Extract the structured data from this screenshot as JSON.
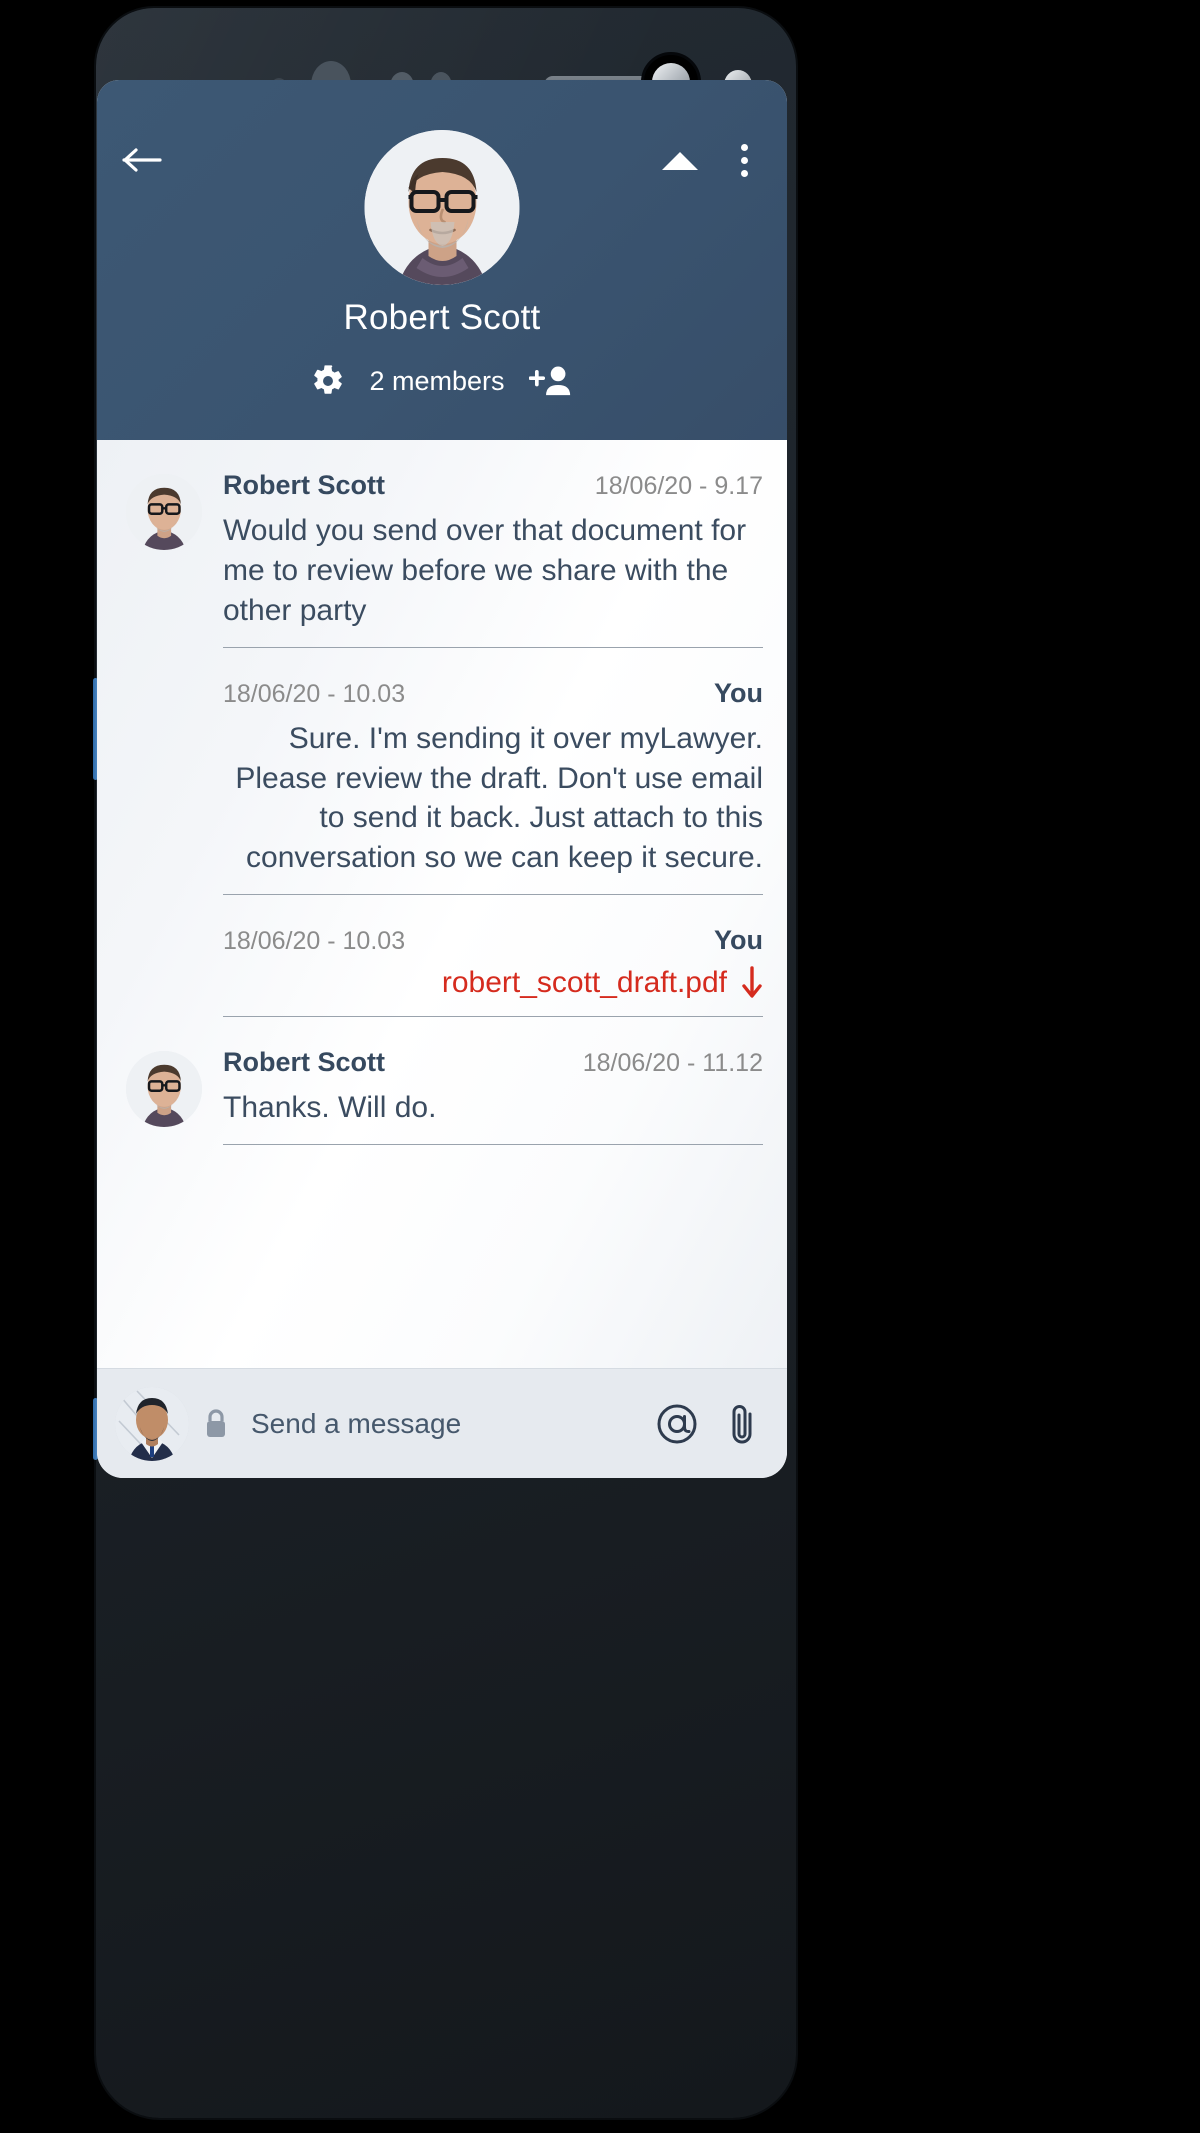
{
  "device": {
    "frame_color": "#1c2228",
    "side_buttons": [
      "volume",
      "power"
    ]
  },
  "header": {
    "title": "Robert Scott",
    "members_label": "2 members",
    "back_icon": "arrow-left-icon",
    "collapse_icon": "triangle-up-icon",
    "overflow_icon": "more-vertical-icon",
    "settings_icon": "gear-icon",
    "add_member_icon": "person-add-icon",
    "background_color": "#3a5470"
  },
  "messages": [
    {
      "sender": "Robert Scott",
      "time": "18/06/20 - 9.17",
      "text": "Would you send over that document for me to review before we share with the other party",
      "direction": "incoming",
      "has_avatar": true
    },
    {
      "sender": "You",
      "time": "18/06/20 - 10.03",
      "text": "Sure.  I'm sending it over myLawyer.  Please review the draft.  Don't use email to send it back.  Just attach to this conversation so we can keep it secure.",
      "direction": "outgoing",
      "has_avatar": false
    },
    {
      "sender": "You",
      "time": "18/06/20 - 10.03",
      "attachment": "robert_scott_draft.pdf",
      "attachment_color": "#d52b1e",
      "download_icon": "download-arrow-icon",
      "direction": "outgoing",
      "has_avatar": false
    },
    {
      "sender": "Robert Scott",
      "time": "18/06/20 - 11.12",
      "text": "Thanks. Will do.",
      "direction": "incoming",
      "has_avatar": true
    }
  ],
  "composer": {
    "placeholder": "Send a message",
    "value": "",
    "lock_icon": "lock-icon",
    "mention_icon": "at-mention-icon",
    "attach_icon": "paperclip-icon",
    "avatar_icon": "user-avatar"
  }
}
